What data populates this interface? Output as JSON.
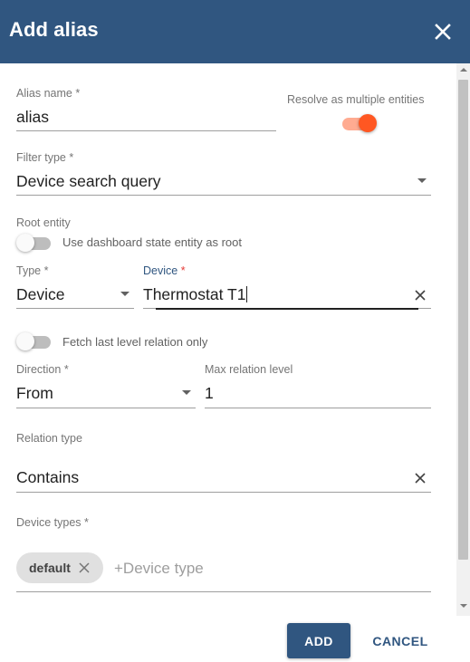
{
  "dialog": {
    "title": "Add alias",
    "close_icon": "close-icon"
  },
  "form": {
    "alias_name": {
      "label": "Alias name",
      "required_mark": "*",
      "value": "alias"
    },
    "resolve_multiple": {
      "label": "Resolve as multiple entities",
      "checked": true
    },
    "filter_type": {
      "label": "Filter type",
      "required_mark": "*",
      "value": "Device search query"
    },
    "root_entity": {
      "label": "Root entity",
      "use_dashboard_state": {
        "label": "Use dashboard state entity as root",
        "checked": false
      }
    },
    "type": {
      "label": "Type",
      "required_mark": "*",
      "value": "Device"
    },
    "device": {
      "label": "Device",
      "required_mark": "*",
      "value": "Thermostat T1"
    },
    "fetch_last_level": {
      "label": "Fetch last level relation only",
      "checked": false
    },
    "direction": {
      "label": "Direction",
      "required_mark": "*",
      "value": "From"
    },
    "max_relation_level": {
      "label": "Max relation level",
      "value": "1"
    },
    "relation_type": {
      "label": "Relation type",
      "value": "Contains"
    },
    "device_types": {
      "label": "Device types",
      "required_mark": "*",
      "chips": [
        "default"
      ],
      "placeholder": "+Device type"
    }
  },
  "actions": {
    "add_label": "ADD",
    "cancel_label": "CANCEL"
  },
  "colors": {
    "primary": "#305680",
    "accent": "#ff5722",
    "required_focused": "#e53935"
  }
}
